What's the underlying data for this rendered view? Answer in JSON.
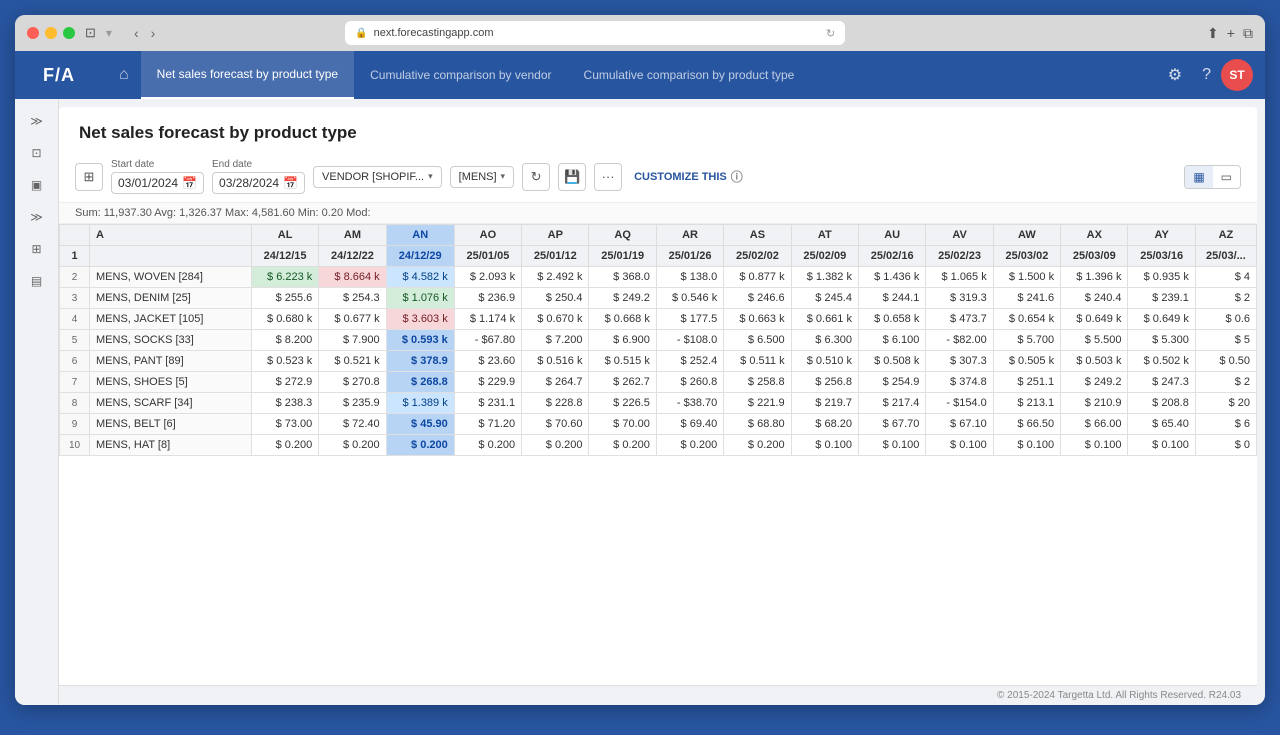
{
  "browser": {
    "url": "next.forecastingapp.com",
    "refresh_icon": "↻"
  },
  "app": {
    "logo": "F/A",
    "nav_tabs": [
      {
        "id": "net-sales",
        "label": "Net sales forecast by product type",
        "active": true
      },
      {
        "id": "cumulative-vendor",
        "label": "Cumulative comparison by vendor",
        "active": false
      },
      {
        "id": "cumulative-product",
        "label": "Cumulative comparison by product type",
        "active": false
      }
    ],
    "user_initials": "ST",
    "page_title": "Net sales forecast by product type",
    "toolbar": {
      "start_label": "Start date",
      "start_value": "03/01/2024",
      "end_label": "End date",
      "end_value": "03/28/2024",
      "vendor_dropdown": "VENDOR [SHOPIF...",
      "category_dropdown": "[MENS]",
      "customize_label": "CUSTOMIZE THIS"
    },
    "stats_bar": "Sum: 11,937.30 Avg: 1,326.37 Max: 4,581.60 Min: 0.20 Mod:",
    "table": {
      "col_headers_row1": [
        "",
        "",
        "AL",
        "AM",
        "AN",
        "AO",
        "AP",
        "AQ",
        "AR",
        "AS",
        "AT",
        "AU",
        "AV",
        "AW",
        "AX",
        "AY",
        "AZ"
      ],
      "col_headers_row2": [
        "",
        "A",
        "24/12/15",
        "24/12/22",
        "24/12/29",
        "25/01/05",
        "25/01/12",
        "25/01/19",
        "25/01/26",
        "25/02/02",
        "25/02/09",
        "25/02/16",
        "25/02/23",
        "25/03/02",
        "25/03/09",
        "25/03/16",
        "25/03/..."
      ],
      "rows": [
        {
          "num": "2",
          "name": "MENS, WOVEN [284]",
          "values": [
            "$ 6.223 k",
            "$ 8.664 k",
            "$ 4.582 k",
            "$ 2.093 k",
            "$ 2.492 k",
            "$ 368.0",
            "$ 138.0",
            "$ 0.877 k",
            "$ 1.382 k",
            "$ 1.436 k",
            "$ 1.065 k",
            "$ 1.500 k",
            "$ 1.396 k",
            "$ 0.935 k",
            "$ 4"
          ],
          "styles": [
            "value-green",
            "value-red",
            "value-blue",
            "value",
            "value",
            "value",
            "value",
            "value",
            "value",
            "value",
            "value",
            "value",
            "value",
            "value",
            "value"
          ]
        },
        {
          "num": "3",
          "name": "MENS, DENIM [25]",
          "values": [
            "$ 255.6",
            "$ 254.3",
            "$ 1.076 k",
            "$ 236.9",
            "$ 250.4",
            "$ 249.2",
            "$ 0.546 k",
            "$ 246.6",
            "$ 245.4",
            "$ 244.1",
            "$ 319.3",
            "$ 241.6",
            "$ 240.4",
            "$ 239.1",
            "$ 2"
          ],
          "styles": [
            "value",
            "value",
            "value-green",
            "value",
            "value",
            "value",
            "value",
            "value",
            "value",
            "value",
            "value",
            "value",
            "value",
            "value",
            "value"
          ]
        },
        {
          "num": "4",
          "name": "MENS, JACKET [105]",
          "values": [
            "$ 0.680 k",
            "$ 0.677 k",
            "$ 3.603 k",
            "$ 1.174 k",
            "$ 0.670 k",
            "$ 0.668 k",
            "$ 177.5",
            "$ 0.663 k",
            "$ 0.661 k",
            "$ 0.658 k",
            "$ 473.7",
            "$ 0.654 k",
            "$ 0.649 k",
            "$ 0.649 k",
            "$ 0.6"
          ],
          "styles": [
            "value",
            "value",
            "value-red",
            "value",
            "value",
            "value",
            "value",
            "value",
            "value",
            "value",
            "value",
            "value",
            "value",
            "value",
            "value"
          ]
        },
        {
          "num": "5",
          "name": "MENS, SOCKS [33]",
          "values": [
            "$ 8.200",
            "$ 7.900",
            "$ 0.593 k",
            "- $67.80",
            "$ 7.200",
            "$ 6.900",
            "- $108.0",
            "$ 6.500",
            "$ 6.300",
            "$ 6.100",
            "- $82.00",
            "$ 5.700",
            "$ 5.500",
            "$ 5.300",
            "$ 5"
          ],
          "styles": [
            "value",
            "value",
            "value",
            "value",
            "value",
            "value",
            "value",
            "value",
            "value",
            "value",
            "value",
            "value",
            "value",
            "value",
            "value"
          ]
        },
        {
          "num": "6",
          "name": "MENS, PANT [89]",
          "values": [
            "$ 0.523 k",
            "$ 0.521 k",
            "$ 378.9",
            "$ 23.60",
            "$ 0.516 k",
            "$ 0.515 k",
            "$ 252.4",
            "$ 0.511 k",
            "$ 0.510 k",
            "$ 0.508 k",
            "$ 307.3",
            "$ 0.505 k",
            "$ 0.503 k",
            "$ 0.502 k",
            "$ 0.50"
          ],
          "styles": [
            "value",
            "value",
            "value",
            "value",
            "value",
            "value",
            "value",
            "value",
            "value",
            "value",
            "value",
            "value",
            "value",
            "value",
            "value"
          ]
        },
        {
          "num": "7",
          "name": "MENS, SHOES [5]",
          "values": [
            "$ 272.9",
            "$ 270.8",
            "$ 268.8",
            "$ 229.9",
            "$ 264.7",
            "$ 262.7",
            "$ 260.8",
            "$ 258.8",
            "$ 256.8",
            "$ 254.9",
            "$ 374.8",
            "$ 251.1",
            "$ 249.2",
            "$ 247.3",
            "$ 2"
          ],
          "styles": [
            "value",
            "value",
            "value",
            "value",
            "value",
            "value",
            "value",
            "value",
            "value",
            "value",
            "value",
            "value",
            "value",
            "value",
            "value"
          ]
        },
        {
          "num": "8",
          "name": "MENS, SCARF [34]",
          "values": [
            "$ 238.3",
            "$ 235.9",
            "$ 1.389 k",
            "$ 231.1",
            "$ 228.8",
            "$ 226.5",
            "- $38.70",
            "$ 221.9",
            "$ 219.7",
            "$ 217.4",
            "- $154.0",
            "$ 213.1",
            "$ 210.9",
            "$ 208.8",
            "$ 20"
          ],
          "styles": [
            "value",
            "value",
            "value-blue",
            "value",
            "value",
            "value",
            "value",
            "value",
            "value",
            "value",
            "value",
            "value",
            "value",
            "value",
            "value"
          ]
        },
        {
          "num": "9",
          "name": "MENS, BELT [6]",
          "values": [
            "$ 73.00",
            "$ 72.40",
            "$ 45.90",
            "$ 71.20",
            "$ 70.60",
            "$ 70.00",
            "$ 69.40",
            "$ 68.80",
            "$ 68.20",
            "$ 67.70",
            "$ 67.10",
            "$ 66.50",
            "$ 66.00",
            "$ 65.40",
            "$ 6"
          ],
          "styles": [
            "value",
            "value",
            "value",
            "value",
            "value",
            "value",
            "value",
            "value",
            "value",
            "value",
            "value",
            "value",
            "value",
            "value",
            "value"
          ]
        },
        {
          "num": "10",
          "name": "MENS, HAT [8]",
          "values": [
            "$ 0.200",
            "$ 0.200",
            "$ 0.200",
            "$ 0.200",
            "$ 0.200",
            "$ 0.200",
            "$ 0.200",
            "$ 0.200",
            "$ 0.100",
            "$ 0.100",
            "$ 0.100",
            "$ 0.100",
            "$ 0.100",
            "$ 0.100",
            "$ 0"
          ],
          "styles": [
            "value",
            "value",
            "value",
            "value",
            "value",
            "value",
            "value",
            "value",
            "value",
            "value",
            "value",
            "value",
            "value",
            "value",
            "value"
          ]
        }
      ]
    },
    "footer": "© 2015-2024 Targetta Ltd. All Rights Reserved. R24.03"
  }
}
